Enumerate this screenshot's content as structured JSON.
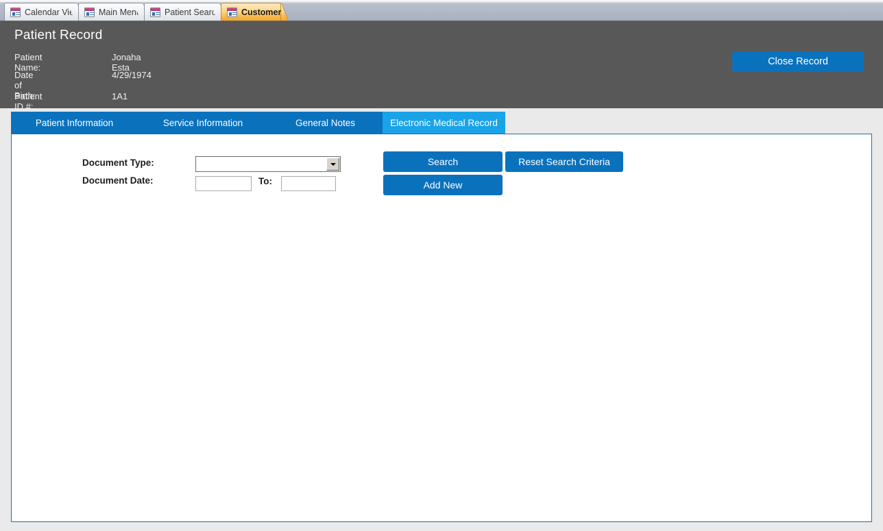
{
  "document_tabs": [
    {
      "label": "Calendar View",
      "icon": "form-icon",
      "active": false
    },
    {
      "label": "Main Menu",
      "icon": "form-icon",
      "active": false
    },
    {
      "label": "Patient Search",
      "icon": "form-icon",
      "active": false
    },
    {
      "label": "Customer",
      "icon": "form-icon",
      "active": true
    }
  ],
  "header": {
    "title": "Patient Record",
    "fields": [
      {
        "label": "Patient Name:",
        "value": "Jonaha Esta"
      },
      {
        "label": "Date of Birth:",
        "value": "4/29/1974"
      },
      {
        "label": "Patient ID #:",
        "value": "1A1"
      }
    ],
    "close_button": "Close Record",
    "background_color": "#585858"
  },
  "subtabs": [
    {
      "label": "Patient Information",
      "active": false
    },
    {
      "label": "Service Information",
      "active": false
    },
    {
      "label": "General Notes",
      "active": false
    },
    {
      "label": "Electronic Medical Record",
      "active": true
    }
  ],
  "search_form": {
    "document_type_label": "Document Type:",
    "document_type_value": "",
    "document_date_label": "Document Date:",
    "date_from_value": "",
    "to_label": "To:",
    "date_to_value": "",
    "search_button": "Search",
    "reset_button": "Reset Search Criteria",
    "add_new_button": "Add New"
  },
  "colors": {
    "accent_blue": "#0a72bd",
    "active_tab_blue": "#1aa3e8",
    "header_gray": "#585858",
    "page_background": "#eaeaea",
    "active_doc_tab_orange": "#f5a623"
  }
}
